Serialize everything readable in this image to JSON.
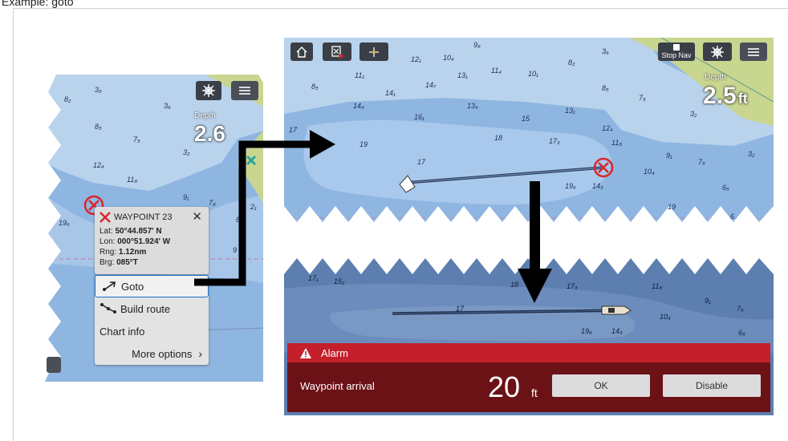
{
  "caption": "Example: goto",
  "left_chart": {
    "depth_label": "Depth",
    "depth_value": "2.6",
    "settings_icon": "ship-wheel-icon",
    "menu_icon": "hamburger-menu-icon",
    "soundings": [
      "3₆",
      "8₂",
      "3₆",
      "8₅",
      "7₅",
      "3₂",
      "12₄",
      "11₈",
      "9₁",
      "7₈",
      "19₆",
      "8",
      "2₁",
      "9"
    ],
    "waypoint": {
      "title": "WAYPOINT 23",
      "lat_label": "Lat:",
      "lat": "50°44.857' N",
      "lon_label": "Lon:",
      "lon": "000°51.924' W",
      "rng_label": "Rng:",
      "rng": "1.12nm",
      "brg_label": "Brg:",
      "brg": "085°T"
    },
    "menu": [
      {
        "label": "Goto",
        "icon": "goto-arrow-icon",
        "selected": true
      },
      {
        "label": "Build route",
        "icon": "route-icon",
        "selected": false
      },
      {
        "label": "Chart info",
        "icon": "",
        "selected": false
      },
      {
        "label": "More options",
        "icon": "chevron-right-icon",
        "selected": false
      }
    ]
  },
  "top_right_chart": {
    "home_icon": "home-icon",
    "mob_icon": "waypoint-flag-icon",
    "compass_icon": "compass-icon",
    "stop_nav_label": "Stop Nav",
    "depth_label": "Depth",
    "depth_value": "2.5",
    "depth_unit": "ft",
    "soundings": [
      "9₈",
      "10₄",
      "12₁",
      "11₁",
      "13₁",
      "11₄",
      "10₁",
      "8₂",
      "3₆",
      "8₅",
      "14₇",
      "14₁",
      "13₄",
      "8₅",
      "7₅",
      "14₄",
      "16₁",
      "15",
      "13₁",
      "12₄",
      "3₂",
      "17",
      "19",
      "18",
      "17₃",
      "11₈",
      "9₁",
      "7₅",
      "3₂",
      "17",
      "10₄",
      "19₆",
      "14₃",
      "6₅",
      "19",
      "6"
    ]
  },
  "bottom_right_chart": {
    "soundings": [
      "17₁",
      "15₂",
      "18",
      "17₃",
      "11₈",
      "9₁",
      "7₅",
      "17",
      "10₄",
      "19₆",
      "14₃",
      "6₅"
    ]
  },
  "alarm": {
    "title": "Alarm",
    "message": "Waypoint arrival",
    "value": "20",
    "unit": "ft",
    "ok_label": "OK",
    "disable_label": "Disable"
  },
  "colors": {
    "sea_light": "#b9d3ec",
    "sea_mid": "#8fb6e0",
    "land": "#c9d690",
    "alarm_red": "#c3202b",
    "alarm_dark": "#6b1216"
  }
}
